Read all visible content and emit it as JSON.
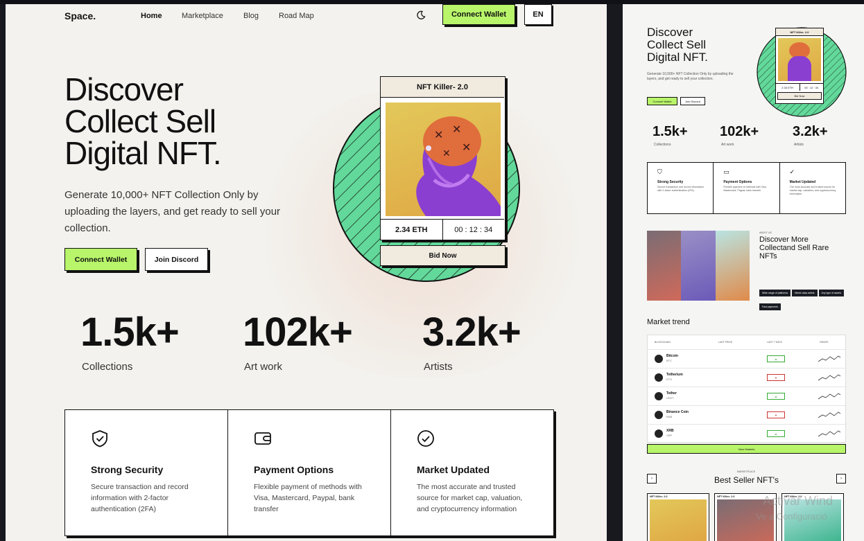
{
  "nav": {
    "logo": "Space.",
    "links": [
      "Home",
      "Marketplace",
      "Blog",
      "Road Map"
    ],
    "connect": "Connect Wallet",
    "lang": "EN"
  },
  "hero": {
    "title": [
      "Discover",
      "Collect Sell",
      "Digital NFT."
    ],
    "desc": "Generate 10,000+ NFT Collection Only by uploading the layers, and get ready to sell your collection.",
    "btn_connect": "Connect Wallet",
    "btn_discord": "Join Discord"
  },
  "card": {
    "title": "NFT Killer- 2.0",
    "price": "2.34 ETH",
    "timer": "00 : 12 : 34",
    "bid": "Bid Now"
  },
  "stats": [
    {
      "num": "1.5k+",
      "label": "Collections"
    },
    {
      "num": "102k+",
      "label": "Art work"
    },
    {
      "num": "3.2k+",
      "label": "Artists"
    }
  ],
  "features": [
    {
      "icon": "shield-check-icon",
      "title": "Strong Security",
      "desc": "Secure transaction and record information with 2-factor authentication (2FA)"
    },
    {
      "icon": "wallet-icon",
      "title": "Payment Options",
      "desc": "Flexible payment of methods with Visa, Mastercard, Paypal, bank transfer"
    },
    {
      "icon": "check-circle-icon",
      "title": "Market Updated",
      "desc": "The most accurate and trusted source for market cap, valuation, and cryptocurrency information"
    }
  ],
  "side": {
    "discover": {
      "label": "ABOUT US",
      "title": [
        "Discover More",
        "Collectand Sell Rare",
        "NFTs"
      ],
      "tags": [
        "Wide range of platforms",
        "World class artists",
        "Any type of assets",
        "Fast payments"
      ]
    },
    "market": {
      "title": "Market trend",
      "headers": [
        "BLOCKCHAIN",
        "LAST PRICE",
        "LAST 7 DAYS",
        "GRAPH"
      ],
      "rows": [
        {
          "name": "Bitcoin",
          "sym": "BTC"
        },
        {
          "name": "Tetherium",
          "sym": "ETH"
        },
        {
          "name": "Tether",
          "sym": "USDT"
        },
        {
          "name": "Binance Coin",
          "sym": "BNB"
        },
        {
          "name": "XRB",
          "sym": "XRP"
        }
      ],
      "view_btn": "View Markets"
    },
    "best": {
      "label": "MARKETPLACE",
      "title": "Best Seller NFT's",
      "cards": [
        "NFT Killer- 2.0",
        "NFT Killer- 2.0",
        "NFT Killer- 2.0"
      ]
    }
  },
  "watermark": [
    "Activar Wind",
    "Ve a Configuració"
  ]
}
